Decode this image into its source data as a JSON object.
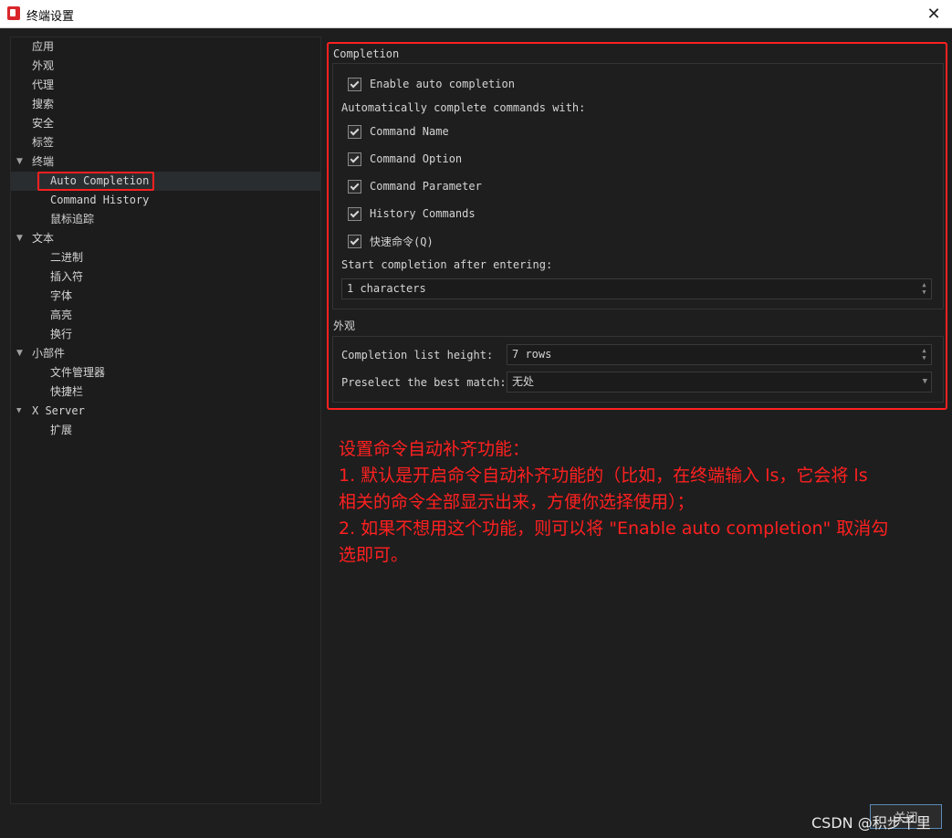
{
  "window": {
    "title": "终端设置"
  },
  "sidebar": {
    "items": [
      {
        "label": "应用"
      },
      {
        "label": "外观"
      },
      {
        "label": "代理"
      },
      {
        "label": "搜索"
      },
      {
        "label": "安全"
      },
      {
        "label": "标签"
      },
      {
        "label": "终端"
      },
      {
        "label": "Auto Completion"
      },
      {
        "label": "Command History"
      },
      {
        "label": "鼠标追踪"
      },
      {
        "label": "文本"
      },
      {
        "label": "二进制"
      },
      {
        "label": "插入符"
      },
      {
        "label": "字体"
      },
      {
        "label": "高亮"
      },
      {
        "label": "换行"
      },
      {
        "label": "小部件"
      },
      {
        "label": "文件管理器"
      },
      {
        "label": "快捷栏"
      },
      {
        "label": "X Server"
      },
      {
        "label": "扩展"
      }
    ],
    "expand_arrow": "▼"
  },
  "completion": {
    "section_title": "Completion",
    "enable_label": "Enable auto completion",
    "enable_checked": true,
    "auto_complete_label": "Automatically complete commands with:",
    "options": [
      {
        "label": "Command Name",
        "checked": true
      },
      {
        "label": "Command Option",
        "checked": true
      },
      {
        "label": "Command Parameter",
        "checked": true
      },
      {
        "label": "History Commands",
        "checked": true
      },
      {
        "label": "快速命令(Q)",
        "checked": true
      }
    ],
    "start_label": "Start completion after entering:",
    "start_value": "1 characters"
  },
  "appearance": {
    "section_title": "外观",
    "list_height_label": "Completion list height:",
    "list_height_value": "7 rows",
    "preselect_label": "Preselect the best match:",
    "preselect_value": "无处"
  },
  "annotation": {
    "lines": [
      "设置命令自动补齐功能：",
      "1. 默认是开启命令自动补齐功能的（比如，在终端输入 ls，它会将 ls",
      "相关的命令全部显示出来，方便你选择使用）；",
      "2. 如果不想用这个功能，则可以将 \"Enable auto completion\" 取消勾",
      "选即可。"
    ],
    "color": "#ff2020"
  },
  "footer": {
    "ok_label": "关闭",
    "watermark": "CSDN @积步千里"
  },
  "colors": {
    "background": "#1e1e1e",
    "highlight_border": "#ff2020",
    "text": "#d4d4d4"
  }
}
